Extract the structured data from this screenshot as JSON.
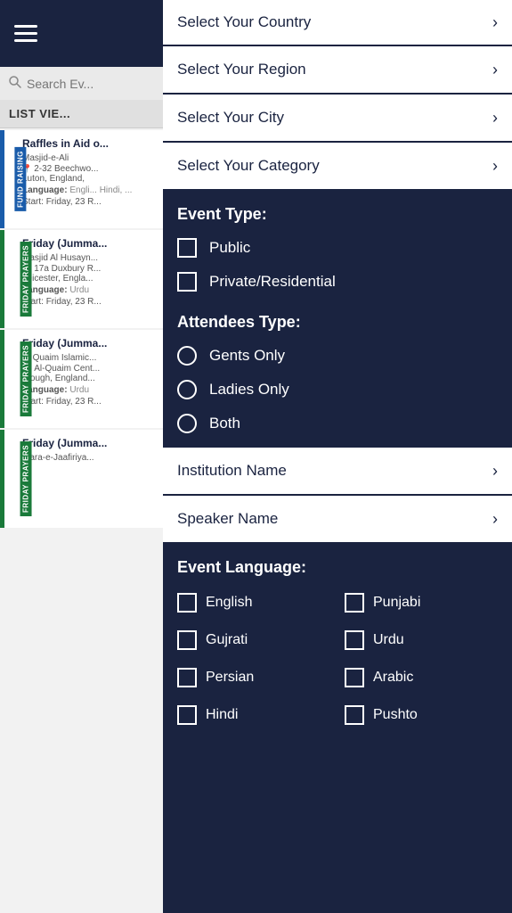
{
  "leftPanel": {
    "searchPlaceholder": "Search Ev...",
    "listViewHeader": "LIST VIE...",
    "events": [
      {
        "id": "e1",
        "title": "Raffles in Aid o...",
        "venue": "Masjid-e-Ali",
        "address": "2-32 Beechwo...",
        "city": "Luton, England,",
        "languageLabel": "Language:",
        "language": "Engli... Hindi, ...",
        "startLabel": "Start:",
        "start": "Friday, 23 R...",
        "category": "FUND RAISING",
        "categoryClass": "fundraising"
      },
      {
        "id": "e2",
        "title": "Friday (Jumma...",
        "venue": "Masjid Al Husayn...",
        "address": "17a Duxbury R...",
        "city": "Leicester, Engla...",
        "languageLabel": "Language:",
        "language": "Urdu",
        "startLabel": "Start:",
        "start": "Friday, 23 R...",
        "category": "FRIDAY PRAYERS",
        "categoryClass": "friday1"
      },
      {
        "id": "e3",
        "title": "Friday (Jumma...",
        "venue": "Al Quaim Islamic...",
        "address": "Al-Quaim Cent...",
        "city": "Slough, England...",
        "languageLabel": "Language:",
        "language": "Urdu",
        "startLabel": "Start:",
        "start": "Friday, 23 R...",
        "category": "FRIDAY PRAYERS",
        "categoryClass": "friday2"
      },
      {
        "id": "e4",
        "title": "Friday (Jumma...",
        "venue": "Idara-e-Jaafiriya...",
        "address": "",
        "city": "",
        "languageLabel": "",
        "language": "",
        "startLabel": "",
        "start": "",
        "category": "FRIDAY PRAYERS",
        "categoryClass": "friday3"
      }
    ]
  },
  "filterPanel": {
    "selectCountryLabel": "Select Your Country",
    "selectRegionLabel": "Select Your Region",
    "selectCityLabel": "Select Your City",
    "selectCategoryLabel": "Select Your Category",
    "eventTypeHeader": "Event Type:",
    "eventTypes": [
      {
        "id": "et1",
        "label": "Public",
        "checked": false
      },
      {
        "id": "et2",
        "label": "Private/Residential",
        "checked": false
      }
    ],
    "attendeesTypeHeader": "Attendees Type:",
    "attendeesTypes": [
      {
        "id": "at1",
        "label": "Gents Only",
        "selected": false
      },
      {
        "id": "at2",
        "label": "Ladies Only",
        "selected": false
      },
      {
        "id": "at3",
        "label": "Both",
        "selected": false
      }
    ],
    "institutionNameLabel": "Institution Name",
    "speakerNameLabel": "Speaker Name",
    "eventLanguageHeader": "Event Language:",
    "languages": [
      {
        "id": "l1",
        "label": "English",
        "checked": false
      },
      {
        "id": "l2",
        "label": "Punjabi",
        "checked": false
      },
      {
        "id": "l3",
        "label": "Gujrati",
        "checked": false
      },
      {
        "id": "l4",
        "label": "Urdu",
        "checked": false
      },
      {
        "id": "l5",
        "label": "Persian",
        "checked": false
      },
      {
        "id": "l6",
        "label": "Arabic",
        "checked": false
      },
      {
        "id": "l7",
        "label": "Hindi",
        "checked": false
      },
      {
        "id": "l8",
        "label": "Pushto",
        "checked": false
      }
    ]
  },
  "icons": {
    "chevron": "›",
    "locationPin": "📍",
    "search": "🔍"
  }
}
